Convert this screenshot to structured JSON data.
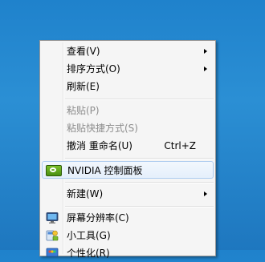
{
  "context_menu": {
    "items": [
      {
        "label": "查看(V)",
        "submenu": true,
        "state": "enabled"
      },
      {
        "label": "排序方式(O)",
        "submenu": true,
        "state": "enabled"
      },
      {
        "label": "刷新(E)",
        "state": "enabled"
      },
      {
        "label": "粘贴(P)",
        "state": "disabled"
      },
      {
        "label": "粘贴快捷方式(S)",
        "state": "disabled"
      },
      {
        "label": "撤消 重命名(U)",
        "shortcut": "Ctrl+Z",
        "state": "enabled"
      },
      {
        "label": "NVIDIA 控制面板",
        "icon": "nvidia-icon",
        "state": "highlighted"
      },
      {
        "label": "新建(W)",
        "submenu": true,
        "state": "enabled"
      },
      {
        "label": "屏幕分辨率(C)",
        "icon": "display-icon",
        "state": "enabled"
      },
      {
        "label": "小工具(G)",
        "icon": "gadgets-icon",
        "state": "enabled"
      },
      {
        "label": "个性化(R)",
        "icon": "personalize-icon",
        "state": "enabled"
      }
    ]
  },
  "colors": {
    "desktop": "#1f82cc",
    "menu_bg": "#f5f5f5",
    "highlight_border": "#aeccef",
    "disabled_text": "#8d8d8d"
  }
}
